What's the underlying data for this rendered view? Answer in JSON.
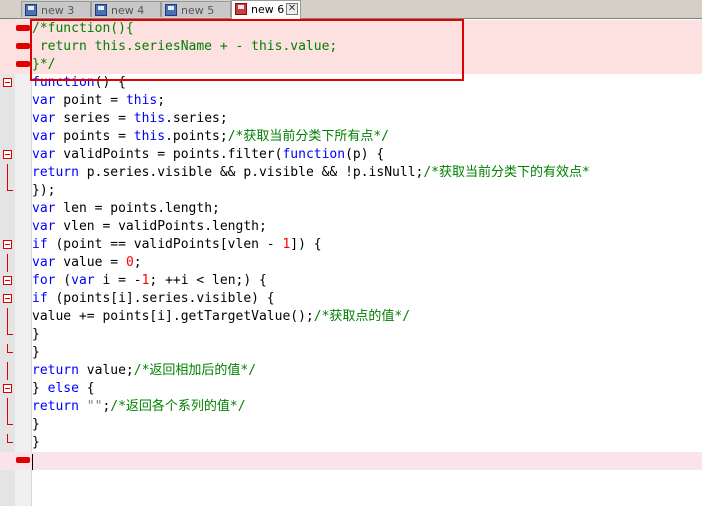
{
  "tabs": [
    {
      "label": "new 3",
      "active": false
    },
    {
      "label": "new 4",
      "active": false
    },
    {
      "label": "new 5",
      "active": false
    },
    {
      "label": "new 6",
      "active": true
    }
  ],
  "lines": [
    {
      "segs": [
        {
          "t": "/*function(){",
          "c": "cm"
        }
      ]
    },
    {
      "segs": [
        {
          "t": " return this.seriesName + - this.value;",
          "c": "cm"
        }
      ]
    },
    {
      "segs": [
        {
          "t": "}*/",
          "c": "cm"
        }
      ]
    },
    {
      "segs": [
        {
          "t": "function",
          "c": "kw"
        },
        {
          "t": "() {",
          "c": "op"
        }
      ]
    },
    {
      "segs": [
        {
          "t": "var",
          "c": "kw"
        },
        {
          "t": " point = ",
          "c": "op"
        },
        {
          "t": "this",
          "c": "kw"
        },
        {
          "t": ";",
          "c": "op"
        }
      ]
    },
    {
      "segs": [
        {
          "t": "var",
          "c": "kw"
        },
        {
          "t": " series = ",
          "c": "op"
        },
        {
          "t": "this",
          "c": "kw"
        },
        {
          "t": ".series;",
          "c": "op"
        }
      ]
    },
    {
      "segs": [
        {
          "t": "var",
          "c": "kw"
        },
        {
          "t": " points = ",
          "c": "op"
        },
        {
          "t": "this",
          "c": "kw"
        },
        {
          "t": ".points;",
          "c": "op"
        },
        {
          "t": "/*获取当前分类下所有点*/",
          "c": "cm"
        }
      ]
    },
    {
      "segs": [
        {
          "t": "var",
          "c": "kw"
        },
        {
          "t": " validPoints = points.filter(",
          "c": "op"
        },
        {
          "t": "function",
          "c": "kw"
        },
        {
          "t": "(p) {",
          "c": "op"
        }
      ]
    },
    {
      "segs": [
        {
          "t": "return",
          "c": "kw"
        },
        {
          "t": " p.series.visible && p.visible && !p.isNull;",
          "c": "op"
        },
        {
          "t": "/*获取当前分类下的有效点*",
          "c": "cm"
        }
      ]
    },
    {
      "segs": [
        {
          "t": "});",
          "c": "op"
        }
      ]
    },
    {
      "segs": [
        {
          "t": "var",
          "c": "kw"
        },
        {
          "t": " len = points.length;",
          "c": "op"
        }
      ]
    },
    {
      "segs": [
        {
          "t": "var",
          "c": "kw"
        },
        {
          "t": " vlen = validPoints.length;",
          "c": "op"
        }
      ]
    },
    {
      "segs": [
        {
          "t": "if",
          "c": "kw"
        },
        {
          "t": " (point == validPoints[vlen - ",
          "c": "op"
        },
        {
          "t": "1",
          "c": "num"
        },
        {
          "t": "]) {",
          "c": "op"
        }
      ]
    },
    {
      "segs": [
        {
          "t": "var",
          "c": "kw"
        },
        {
          "t": " value = ",
          "c": "op"
        },
        {
          "t": "0",
          "c": "num"
        },
        {
          "t": ";",
          "c": "op"
        }
      ]
    },
    {
      "segs": [
        {
          "t": "for",
          "c": "kw"
        },
        {
          "t": " (",
          "c": "op"
        },
        {
          "t": "var",
          "c": "kw"
        },
        {
          "t": " i = -",
          "c": "op"
        },
        {
          "t": "1",
          "c": "num"
        },
        {
          "t": "; ++i < len;) {",
          "c": "op"
        }
      ]
    },
    {
      "segs": [
        {
          "t": "if",
          "c": "kw"
        },
        {
          "t": " (points[i].series.visible) {",
          "c": "op"
        }
      ]
    },
    {
      "segs": [
        {
          "t": "value += points[i].getTargetValue();",
          "c": "op"
        },
        {
          "t": "/*获取点的值*/",
          "c": "cm"
        }
      ]
    },
    {
      "segs": [
        {
          "t": "}",
          "c": "op"
        }
      ]
    },
    {
      "segs": [
        {
          "t": "}",
          "c": "op"
        }
      ]
    },
    {
      "segs": [
        {
          "t": "return",
          "c": "kw"
        },
        {
          "t": " value;",
          "c": "op"
        },
        {
          "t": "/*返回相加后的值*/",
          "c": "cm"
        }
      ]
    },
    {
      "segs": [
        {
          "t": "} ",
          "c": "op"
        },
        {
          "t": "else",
          "c": "kw"
        },
        {
          "t": " {",
          "c": "op"
        }
      ]
    },
    {
      "segs": [
        {
          "t": "return",
          "c": "kw"
        },
        {
          "t": " ",
          "c": "op"
        },
        {
          "t": "\"\"",
          "c": "str"
        },
        {
          "t": ";",
          "c": "op"
        },
        {
          "t": "/*返回各个系列的值*/",
          "c": "cm"
        }
      ]
    },
    {
      "segs": [
        {
          "t": "}",
          "c": "op"
        }
      ]
    },
    {
      "segs": [
        {
          "t": "}",
          "c": "op"
        }
      ]
    },
    {
      "segs": []
    }
  ]
}
